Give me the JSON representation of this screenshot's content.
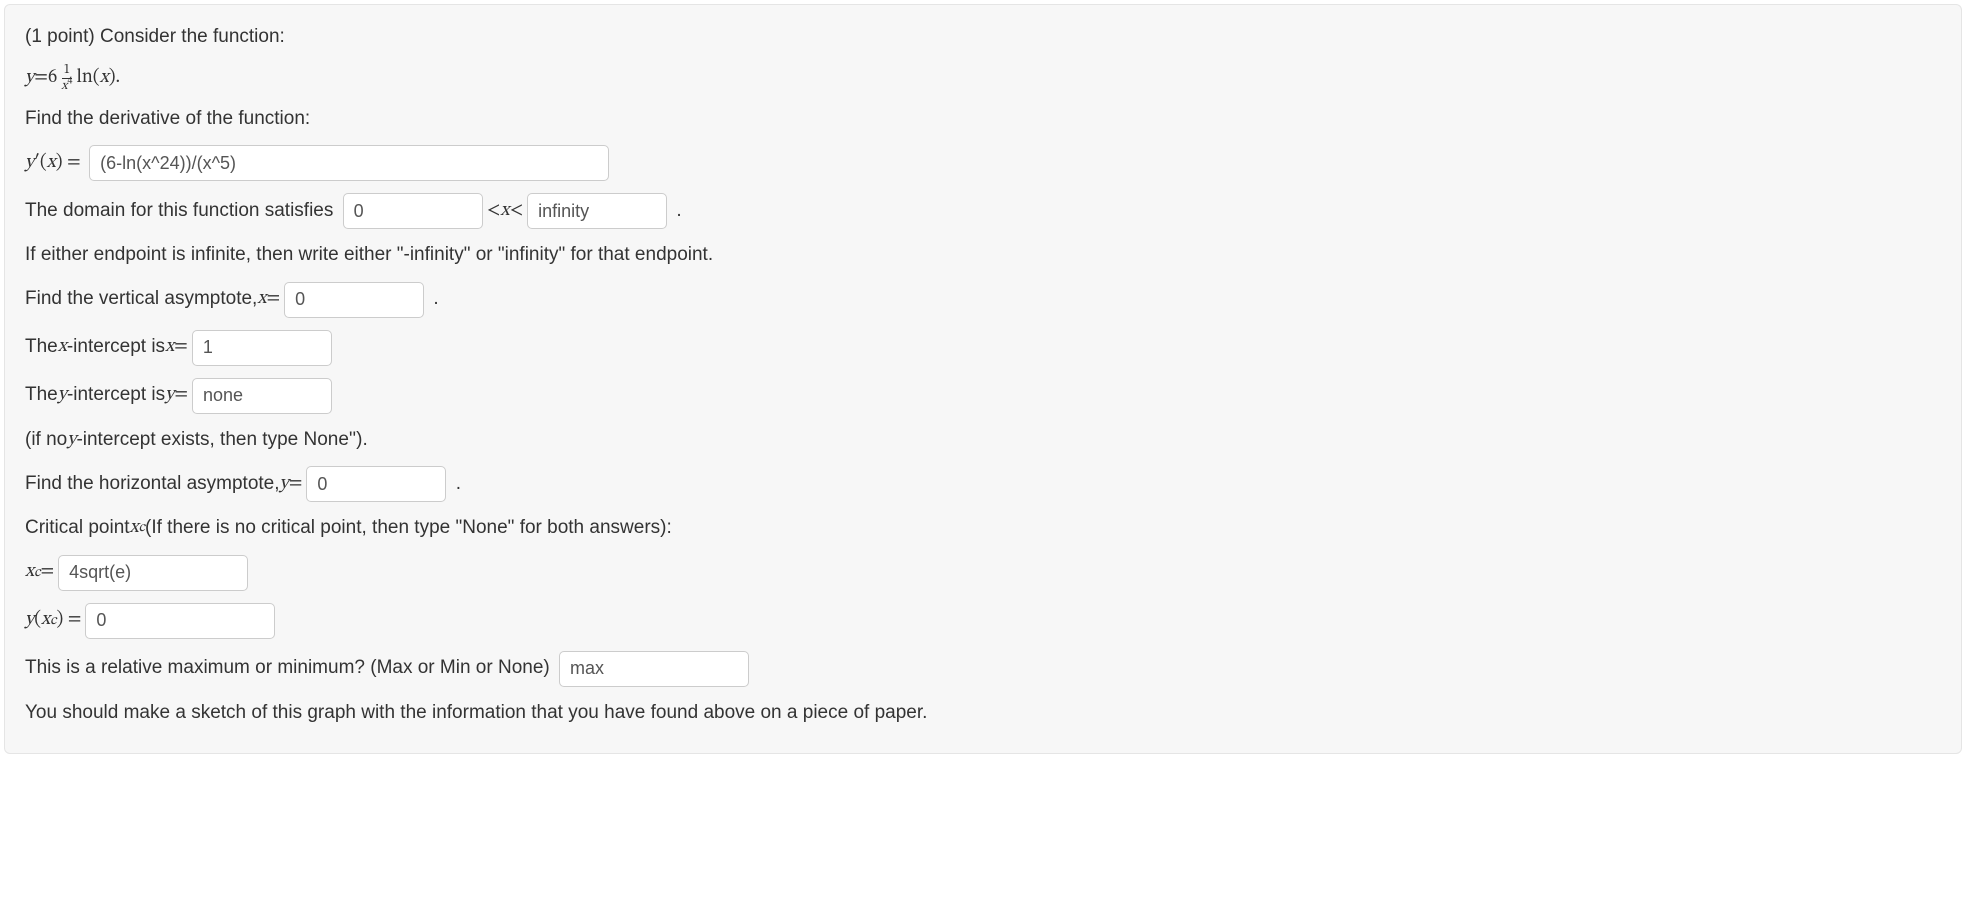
{
  "header": {
    "points_prefix": "(1 point) Consider the function:",
    "function_y": "y",
    "equals": " = ",
    "coeff": "6",
    "frac_num": "1",
    "frac_den_base": "x",
    "frac_den_exp": "4",
    "ln_text": "ln(",
    "ln_arg": "x",
    "ln_close": ").",
    "find_derivative": "Find the derivative of the function:"
  },
  "derivative": {
    "label_y": "y",
    "label_prime": "′",
    "label_paren": "(x) = ",
    "value": "(6-ln(x^24))/(x^5)"
  },
  "domain": {
    "text_before": "The domain for this function satisfies ",
    "lower_value": "0",
    "between": " < ",
    "x_var": "x",
    "between2": " < ",
    "upper_value": "infinity",
    "period": " .",
    "instruction": "If either endpoint is infinite, then write either \"-infinity\" or \"infinity\" for that endpoint."
  },
  "vertical_asymptote": {
    "text": "Find the vertical asymptote, ",
    "var": "x",
    "eq": " = ",
    "value": "0",
    "period": " ."
  },
  "x_intercept": {
    "text": "The ",
    "var": "x",
    "text2": "-intercept is ",
    "var2": "x",
    "eq": " = ",
    "value": "1"
  },
  "y_intercept": {
    "text": "The ",
    "var": "y",
    "text2": "-intercept is ",
    "var2": "y",
    "eq": " = ",
    "value": "none",
    "note": "(if no ",
    "note_var": "y",
    "note2": "-intercept exists, then type None'')."
  },
  "horizontal_asymptote": {
    "text": "Find the horizontal asymptote, ",
    "var": "y",
    "eq": " = ",
    "value": "0",
    "period": " ."
  },
  "critical_point": {
    "text": "Critical point ",
    "xc": "x",
    "sub": "c",
    "text2": " (If there is no critical point, then type \"None\" for both answers):",
    "xc_label": "x",
    "xc_sub": "c",
    "xc_eq": " = ",
    "xc_value": "4sqrt(e)",
    "yxc_y": "y",
    "yxc_open": "(",
    "yxc_x": "x",
    "yxc_sub": "c",
    "yxc_close": ") = ",
    "yxc_value": "0"
  },
  "max_min": {
    "text": "This is a relative maximum or minimum? (Max or Min or None) ",
    "value": "max"
  },
  "footer": {
    "text": "You should make a sketch of this graph with the information that you have found above on a piece of paper."
  }
}
